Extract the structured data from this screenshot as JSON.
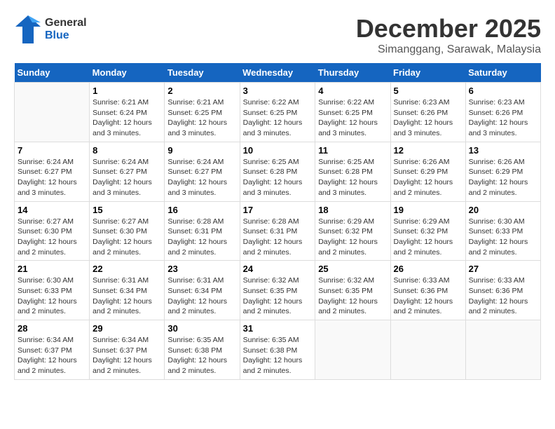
{
  "header": {
    "logo_general": "General",
    "logo_blue": "Blue",
    "month_title": "December 2025",
    "location": "Simanggang, Sarawak, Malaysia"
  },
  "days_of_week": [
    "Sunday",
    "Monday",
    "Tuesday",
    "Wednesday",
    "Thursday",
    "Friday",
    "Saturday"
  ],
  "weeks": [
    [
      {
        "num": "",
        "info": ""
      },
      {
        "num": "1",
        "info": "Sunrise: 6:21 AM\nSunset: 6:24 PM\nDaylight: 12 hours\nand 3 minutes."
      },
      {
        "num": "2",
        "info": "Sunrise: 6:21 AM\nSunset: 6:25 PM\nDaylight: 12 hours\nand 3 minutes."
      },
      {
        "num": "3",
        "info": "Sunrise: 6:22 AM\nSunset: 6:25 PM\nDaylight: 12 hours\nand 3 minutes."
      },
      {
        "num": "4",
        "info": "Sunrise: 6:22 AM\nSunset: 6:25 PM\nDaylight: 12 hours\nand 3 minutes."
      },
      {
        "num": "5",
        "info": "Sunrise: 6:23 AM\nSunset: 6:26 PM\nDaylight: 12 hours\nand 3 minutes."
      },
      {
        "num": "6",
        "info": "Sunrise: 6:23 AM\nSunset: 6:26 PM\nDaylight: 12 hours\nand 3 minutes."
      }
    ],
    [
      {
        "num": "7",
        "info": "Sunrise: 6:24 AM\nSunset: 6:27 PM\nDaylight: 12 hours\nand 3 minutes."
      },
      {
        "num": "8",
        "info": "Sunrise: 6:24 AM\nSunset: 6:27 PM\nDaylight: 12 hours\nand 3 minutes."
      },
      {
        "num": "9",
        "info": "Sunrise: 6:24 AM\nSunset: 6:27 PM\nDaylight: 12 hours\nand 3 minutes."
      },
      {
        "num": "10",
        "info": "Sunrise: 6:25 AM\nSunset: 6:28 PM\nDaylight: 12 hours\nand 3 minutes."
      },
      {
        "num": "11",
        "info": "Sunrise: 6:25 AM\nSunset: 6:28 PM\nDaylight: 12 hours\nand 3 minutes."
      },
      {
        "num": "12",
        "info": "Sunrise: 6:26 AM\nSunset: 6:29 PM\nDaylight: 12 hours\nand 2 minutes."
      },
      {
        "num": "13",
        "info": "Sunrise: 6:26 AM\nSunset: 6:29 PM\nDaylight: 12 hours\nand 2 minutes."
      }
    ],
    [
      {
        "num": "14",
        "info": "Sunrise: 6:27 AM\nSunset: 6:30 PM\nDaylight: 12 hours\nand 2 minutes."
      },
      {
        "num": "15",
        "info": "Sunrise: 6:27 AM\nSunset: 6:30 PM\nDaylight: 12 hours\nand 2 minutes."
      },
      {
        "num": "16",
        "info": "Sunrise: 6:28 AM\nSunset: 6:31 PM\nDaylight: 12 hours\nand 2 minutes."
      },
      {
        "num": "17",
        "info": "Sunrise: 6:28 AM\nSunset: 6:31 PM\nDaylight: 12 hours\nand 2 minutes."
      },
      {
        "num": "18",
        "info": "Sunrise: 6:29 AM\nSunset: 6:32 PM\nDaylight: 12 hours\nand 2 minutes."
      },
      {
        "num": "19",
        "info": "Sunrise: 6:29 AM\nSunset: 6:32 PM\nDaylight: 12 hours\nand 2 minutes."
      },
      {
        "num": "20",
        "info": "Sunrise: 6:30 AM\nSunset: 6:33 PM\nDaylight: 12 hours\nand 2 minutes."
      }
    ],
    [
      {
        "num": "21",
        "info": "Sunrise: 6:30 AM\nSunset: 6:33 PM\nDaylight: 12 hours\nand 2 minutes."
      },
      {
        "num": "22",
        "info": "Sunrise: 6:31 AM\nSunset: 6:34 PM\nDaylight: 12 hours\nand 2 minutes."
      },
      {
        "num": "23",
        "info": "Sunrise: 6:31 AM\nSunset: 6:34 PM\nDaylight: 12 hours\nand 2 minutes."
      },
      {
        "num": "24",
        "info": "Sunrise: 6:32 AM\nSunset: 6:35 PM\nDaylight: 12 hours\nand 2 minutes."
      },
      {
        "num": "25",
        "info": "Sunrise: 6:32 AM\nSunset: 6:35 PM\nDaylight: 12 hours\nand 2 minutes."
      },
      {
        "num": "26",
        "info": "Sunrise: 6:33 AM\nSunset: 6:36 PM\nDaylight: 12 hours\nand 2 minutes."
      },
      {
        "num": "27",
        "info": "Sunrise: 6:33 AM\nSunset: 6:36 PM\nDaylight: 12 hours\nand 2 minutes."
      }
    ],
    [
      {
        "num": "28",
        "info": "Sunrise: 6:34 AM\nSunset: 6:37 PM\nDaylight: 12 hours\nand 2 minutes."
      },
      {
        "num": "29",
        "info": "Sunrise: 6:34 AM\nSunset: 6:37 PM\nDaylight: 12 hours\nand 2 minutes."
      },
      {
        "num": "30",
        "info": "Sunrise: 6:35 AM\nSunset: 6:38 PM\nDaylight: 12 hours\nand 2 minutes."
      },
      {
        "num": "31",
        "info": "Sunrise: 6:35 AM\nSunset: 6:38 PM\nDaylight: 12 hours\nand 2 minutes."
      },
      {
        "num": "",
        "info": ""
      },
      {
        "num": "",
        "info": ""
      },
      {
        "num": "",
        "info": ""
      }
    ]
  ]
}
